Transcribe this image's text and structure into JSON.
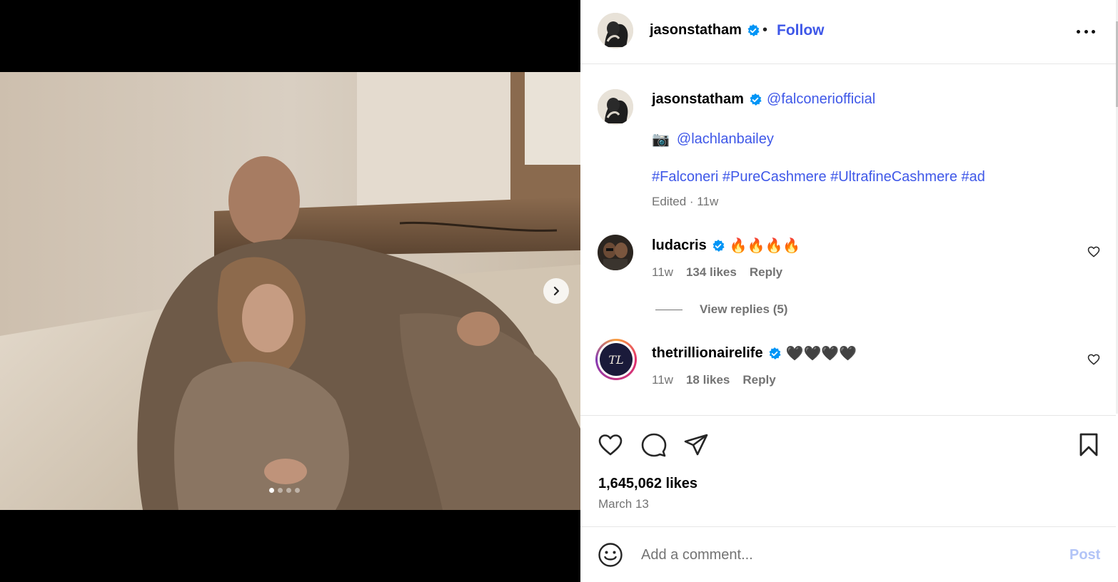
{
  "post": {
    "username": "jasonstatham",
    "follow_label": "Follow",
    "separator": "•"
  },
  "caption": {
    "username": "jasonstatham",
    "mention_brand": "@falconeriofficial",
    "camera_emoji": "📷",
    "mention_photographer": "@lachlanbailey",
    "hashtags": "#Falconeri #PureCashmere #UltrafineCashmere #ad",
    "meta": "Edited · 11w"
  },
  "comments": [
    {
      "username": "ludacris",
      "text": "🔥🔥🔥🔥",
      "age": "11w",
      "likes": "134 likes",
      "reply_label": "Reply",
      "view_replies": "View replies (5)"
    },
    {
      "username": "thetrillionairelife",
      "text": "🖤🖤🖤🖤",
      "age": "11w",
      "likes": "18 likes",
      "reply_label": "Reply",
      "avatar_monogram": "TL"
    }
  ],
  "stats": {
    "likes": "1,645,062 likes",
    "date": "March 13"
  },
  "composer": {
    "placeholder": "Add a comment...",
    "post_label": "Post"
  },
  "carousel": {
    "current": 1,
    "total": 4
  },
  "colors": {
    "link_blue": "#3f58e8",
    "verified_blue": "#0095f6",
    "muted_gray": "#737373",
    "post_disabled": "#b2c4f7"
  },
  "icons": [
    "verified-badge-icon",
    "more-options-icon",
    "heart-icon",
    "comment-icon",
    "share-icon",
    "bookmark-icon",
    "emoji-icon",
    "chevron-right-icon"
  ]
}
